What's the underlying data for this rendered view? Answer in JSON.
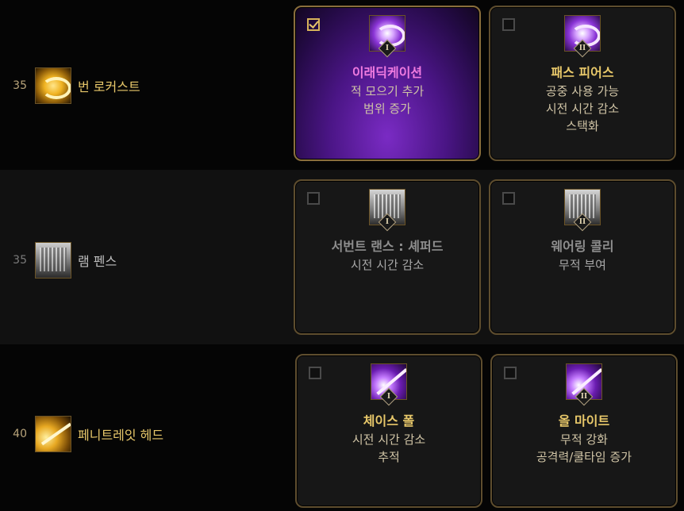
{
  "rows": [
    {
      "level": "35",
      "skill": {
        "name": "번 로커스트",
        "icon": "burn-locust-icon"
      },
      "options": [
        {
          "checked": true,
          "badge": "I",
          "title": "이래딕케이션",
          "desc": [
            "적 모으기 추가",
            "범위 증가"
          ]
        },
        {
          "checked": false,
          "badge": "II",
          "title": "패스 피어스",
          "desc": [
            "공중 사용 가능",
            "시전 시간 감소",
            "스택화"
          ]
        }
      ]
    },
    {
      "level": "35",
      "skill": {
        "name": "램 펜스",
        "icon": "lamb-fence-icon"
      },
      "options": [
        {
          "checked": false,
          "badge": "I",
          "title": "서번트 랜스 : 셰퍼드",
          "desc": [
            "시전 시간 감소"
          ]
        },
        {
          "checked": false,
          "badge": "II",
          "title": "웨어링 콜리",
          "desc": [
            "무적 부여"
          ]
        }
      ]
    },
    {
      "level": "40",
      "skill": {
        "name": "페니트레잇 헤드",
        "icon": "penetrate-head-icon"
      },
      "options": [
        {
          "checked": false,
          "badge": "I",
          "title": "체이스 폴",
          "desc": [
            "시전 시간 감소",
            "추적"
          ]
        },
        {
          "checked": false,
          "badge": "II",
          "title": "올 마이트",
          "desc": [
            "무적 강화",
            "공격력/쿨타임 증가"
          ]
        }
      ]
    }
  ],
  "colors": {
    "gold": "#e8c86a",
    "pink": "#f07be0",
    "frame": "#5e4d2e",
    "active_purple": "#7a2bc4"
  }
}
